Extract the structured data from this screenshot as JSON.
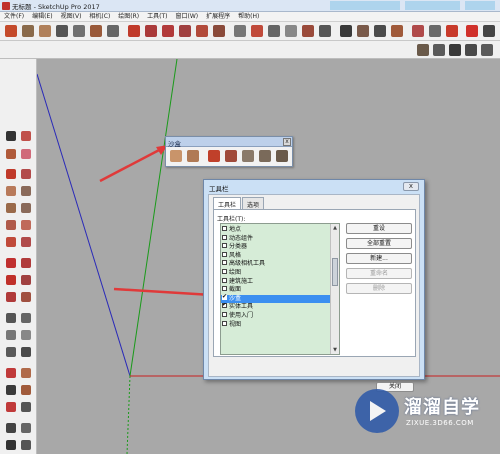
{
  "app": {
    "title": "无标题 - SketchUp Pro 2017"
  },
  "menubar": [
    "文件(F)",
    "编辑(E)",
    "视图(V)",
    "相机(C)",
    "绘图(R)",
    "工具(T)",
    "窗口(W)",
    "扩展程序",
    "帮助(H)"
  ],
  "sandbox_toolbar": {
    "title": "沙盒",
    "close": "x"
  },
  "toolbars_dialog": {
    "title": "工具栏",
    "close": "x",
    "tabs": [
      "工具栏",
      "选项"
    ],
    "list_label": "工具栏(T):",
    "items": [
      {
        "label": "地点",
        "checked": false,
        "selected": false
      },
      {
        "label": "动态组件",
        "checked": false,
        "selected": false
      },
      {
        "label": "分类器",
        "checked": false,
        "selected": false
      },
      {
        "label": "风格",
        "checked": false,
        "selected": false
      },
      {
        "label": "高级相机工具",
        "checked": false,
        "selected": false
      },
      {
        "label": "绘图",
        "checked": false,
        "selected": false
      },
      {
        "label": "建筑施工",
        "checked": false,
        "selected": false
      },
      {
        "label": "截面",
        "checked": false,
        "selected": false
      },
      {
        "label": "沙盒",
        "checked": true,
        "selected": true
      },
      {
        "label": "实体工具",
        "checked": true,
        "selected": false
      },
      {
        "label": "使用入门",
        "checked": false,
        "selected": false
      },
      {
        "label": "视图",
        "checked": false,
        "selected": false
      }
    ],
    "buttons": [
      {
        "label": "重设",
        "enabled": true
      },
      {
        "label": "全部重置",
        "enabled": true
      },
      {
        "label": "新建...",
        "enabled": true
      },
      {
        "label": "重命名",
        "enabled": false
      },
      {
        "label": "删除",
        "enabled": false
      }
    ],
    "close_button": "关闭"
  },
  "watermark": {
    "brand": "溜溜自学",
    "url": "ZIXUE.3D66.COM"
  },
  "colors": {
    "annotation_arrow": "#e03a3a",
    "selection": "#3b8ff0",
    "list_bg": "#d6ecd7",
    "dialog_frame": "#cbe0f5"
  }
}
